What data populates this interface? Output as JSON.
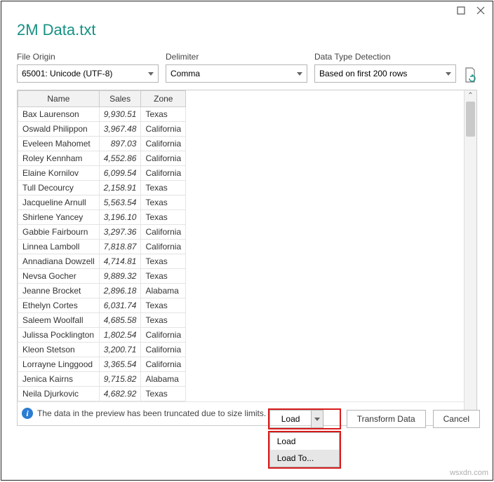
{
  "window": {
    "title": "2M Data.txt",
    "maximize_icon": "maximize",
    "close_icon": "close"
  },
  "controls": {
    "file_origin": {
      "label": "File Origin",
      "value": "65001: Unicode (UTF-8)"
    },
    "delimiter": {
      "label": "Delimiter",
      "value": "Comma"
    },
    "detection": {
      "label": "Data Type Detection",
      "value": "Based on first 200 rows"
    }
  },
  "table": {
    "headers": [
      "Name",
      "Sales",
      "Zone"
    ],
    "rows": [
      {
        "name": "Bax Laurenson",
        "sales": "9,930.51",
        "zone": "Texas"
      },
      {
        "name": "Oswald Philippon",
        "sales": "3,967.48",
        "zone": "California"
      },
      {
        "name": "Eveleen Mahomet",
        "sales": "897.03",
        "zone": "California"
      },
      {
        "name": "Roley Kennham",
        "sales": "4,552.86",
        "zone": "California"
      },
      {
        "name": "Elaine Kornilov",
        "sales": "6,099.54",
        "zone": "California"
      },
      {
        "name": "Tull Decourcy",
        "sales": "2,158.91",
        "zone": "Texas"
      },
      {
        "name": "Jacqueline Arnull",
        "sales": "5,563.54",
        "zone": "Texas"
      },
      {
        "name": "Shirlene Yancey",
        "sales": "3,196.10",
        "zone": "Texas"
      },
      {
        "name": "Gabbie Fairbourn",
        "sales": "3,297.36",
        "zone": "California"
      },
      {
        "name": "Linnea Lamboll",
        "sales": "7,818.87",
        "zone": "California"
      },
      {
        "name": "Annadiana Dowzell",
        "sales": "4,714.81",
        "zone": "Texas"
      },
      {
        "name": "Nevsa Gocher",
        "sales": "9,889.32",
        "zone": "Texas"
      },
      {
        "name": "Jeanne Brocket",
        "sales": "2,896.18",
        "zone": "Alabama"
      },
      {
        "name": "Ethelyn Cortes",
        "sales": "6,031.74",
        "zone": "Texas"
      },
      {
        "name": "Saleem Woolfall",
        "sales": "4,685.58",
        "zone": "Texas"
      },
      {
        "name": "Julissa Pocklington",
        "sales": "1,802.54",
        "zone": "California"
      },
      {
        "name": "Kleon Stetson",
        "sales": "3,200.71",
        "zone": "California"
      },
      {
        "name": "Lorrayne Linggood",
        "sales": "3,365.54",
        "zone": "California"
      },
      {
        "name": "Jenica Kairns",
        "sales": "9,715.82",
        "zone": "Alabama"
      },
      {
        "name": "Neila Djurkovic",
        "sales": "4,682.92",
        "zone": "Texas"
      }
    ],
    "truncated_msg": "The data in the preview has been truncated due to size limits."
  },
  "footer": {
    "load": "Load",
    "transform": "Transform Data",
    "cancel": "Cancel",
    "menu": {
      "load": "Load",
      "load_to": "Load To..."
    }
  },
  "watermark": "wsxdn.com"
}
